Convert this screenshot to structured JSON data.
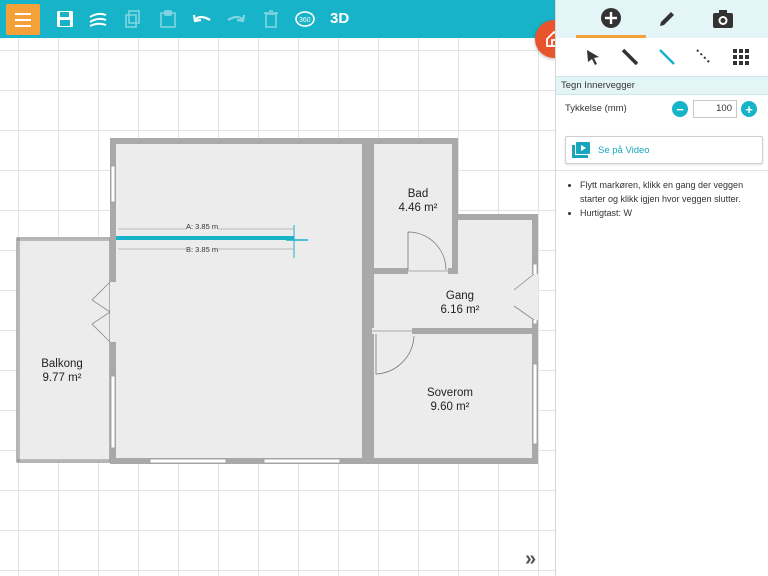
{
  "toolbar": {
    "icons": [
      "menu-icon",
      "save-icon",
      "share-icon",
      "copy-icon",
      "paste-icon",
      "undo-icon",
      "redo-icon",
      "trash-icon",
      "rotate-360-icon"
    ],
    "view_3d_label": "3D",
    "accent_color": "#17b3c9",
    "menu_color": "#f4a13a"
  },
  "panel": {
    "tabs": [
      "add-icon",
      "pencil-icon",
      "camera-icon"
    ],
    "active_tab": "add-icon",
    "tools": [
      "cursor-icon",
      "wall-icon",
      "inner-wall-icon",
      "dotted-line-icon",
      "grid-icon"
    ],
    "active_tool": "inner-wall-icon",
    "section_title": "Tegn Innervegger",
    "thickness_label": "Tykkelse (mm)",
    "thickness_value": "100",
    "video_label": "Se på Video",
    "help_items": [
      "Flytt markøren, klikk en gang der veggen starter og klikk igjen hvor veggen slutter.",
      "Hurtigtast: W"
    ]
  },
  "floorplan": {
    "rooms": [
      {
        "name": "Bad",
        "area": "4.46 m²"
      },
      {
        "name": "Gang",
        "area": "6.16 m²"
      },
      {
        "name": "Balkong",
        "area": "9.77 m²"
      },
      {
        "name": "Soverom",
        "area": "9.60 m²"
      }
    ],
    "dimension_a": "A: 3.85 m",
    "dimension_b": "B: 3.85 m",
    "fab_color": "#e8552c"
  }
}
